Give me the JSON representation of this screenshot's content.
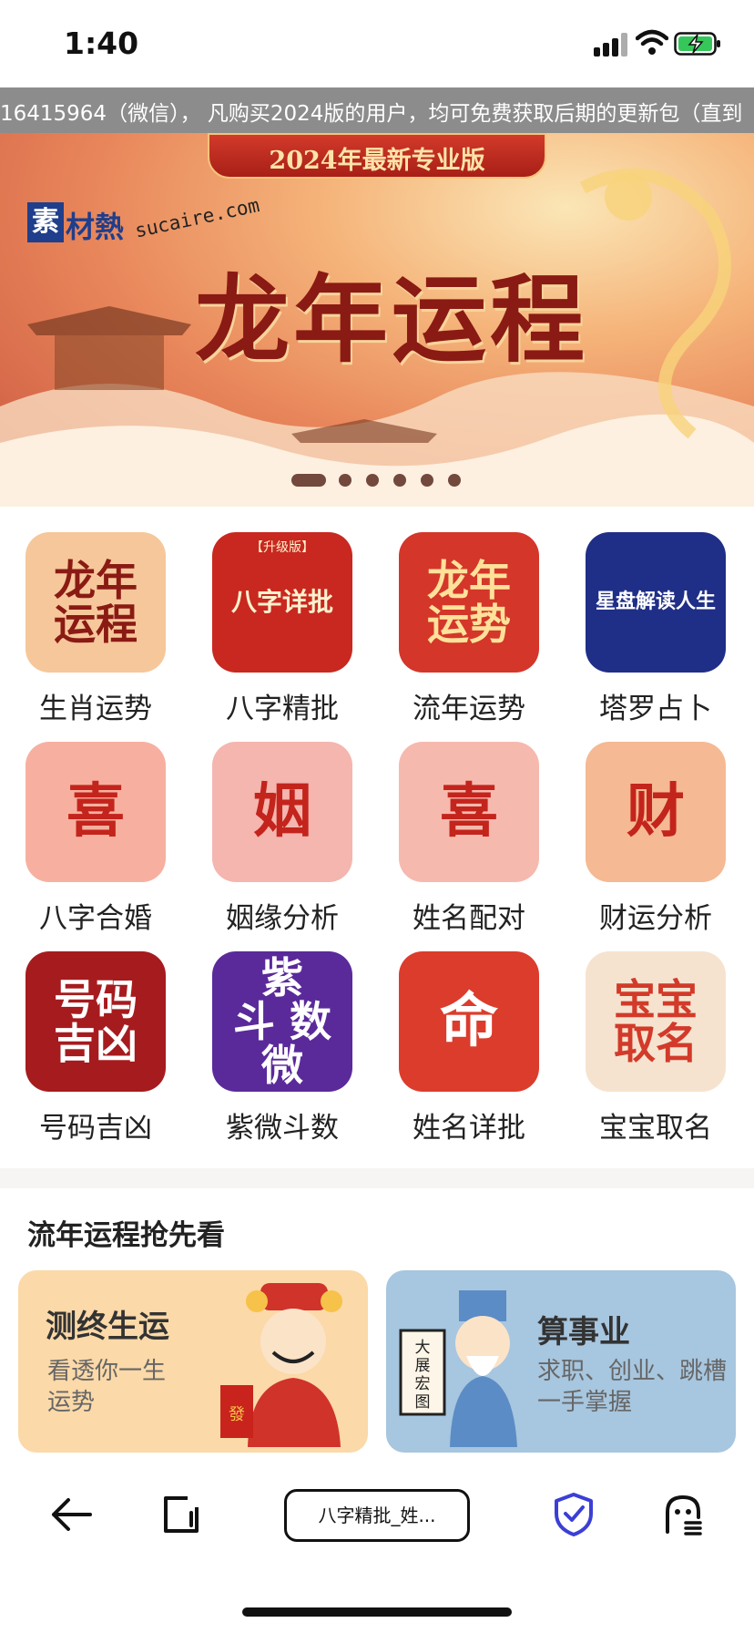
{
  "status_bar": {
    "time": "1:40"
  },
  "marquee": {
    "text": "16415964（微信）， 凡购买2024版的用户，均可免费获取后期的更新包（直到"
  },
  "banner": {
    "subtitle": "2024年最新专业版",
    "title": "龙年运程",
    "logo_char": "素",
    "logo_text": "材熱",
    "logo_url": "sucaire.com",
    "active_slide": 1,
    "slide_count": 6
  },
  "grid": {
    "items": [
      {
        "label": "生肖运势",
        "icon": "dragon-zodiac-icon",
        "glyph": "龙年\n运程",
        "bg": "#f6c79a",
        "fg": "#8a1a14"
      },
      {
        "label": "八字精批",
        "icon": "bazi-chart-icon",
        "glyph": "八字详批",
        "tag": "【升级版】",
        "bg": "#c8281f",
        "fg": "#fff1cf"
      },
      {
        "label": "流年运势",
        "icon": "dragon-fortune-icon",
        "glyph": "龙年\n运势",
        "bg": "#d4362a",
        "fg": "#ffe19a"
      },
      {
        "label": "塔罗占卜",
        "icon": "astrology-wheel-icon",
        "glyph": "星盘解读人生",
        "bg": "#1f2e86",
        "fg": "#ffffff"
      },
      {
        "label": "八字合婚",
        "icon": "bride-icon",
        "glyph": "喜",
        "bg": "#f7b0a0",
        "fg": "#c3241c"
      },
      {
        "label": "姻缘分析",
        "icon": "matchmaker-elder-icon",
        "glyph": "姻",
        "bg": "#f4b6ae",
        "fg": "#c3241c"
      },
      {
        "label": "姓名配对",
        "icon": "couple-icon",
        "glyph": "喜",
        "bg": "#f6b9ae",
        "fg": "#c3241c"
      },
      {
        "label": "财运分析",
        "icon": "god-of-wealth-icon",
        "glyph": "财",
        "bg": "#f5b993",
        "fg": "#c3241c"
      },
      {
        "label": "号码吉凶",
        "icon": "number-fortune-icon",
        "glyph": "号码\n吉凶",
        "bg": "#a61b1e",
        "fg": "#ffffff"
      },
      {
        "label": "紫微斗数",
        "icon": "ziwei-icon",
        "glyph": "紫\n斗  数\n微",
        "bg": "#5a2a9a",
        "fg": "#ffffff"
      },
      {
        "label": "姓名详批",
        "icon": "bagua-fate-icon",
        "glyph": "命",
        "bg": "#dc3c2c",
        "fg": "#ffffff"
      },
      {
        "label": "宝宝取名",
        "icon": "baby-naming-icon",
        "glyph": "宝宝\n取名",
        "bg": "#f6e3cf",
        "fg": "#d23a2a"
      }
    ]
  },
  "section": {
    "title": "流年运程抢先看"
  },
  "cards": [
    {
      "title": "测终生运",
      "desc": "看透你一生\n运势",
      "icon": "god-of-wealth-illustration-icon"
    },
    {
      "title": "算事业",
      "desc": "求职、创业、跳槽\n一手掌握",
      "icon": "sage-scroll-illustration-icon",
      "scroll_text": "大展宏图"
    }
  ],
  "toolbar": {
    "url_label": "八字精批_姓...",
    "colors": {
      "accent": "#3b3fd6"
    }
  },
  "colors": {
    "marquee_bg": "#8c8c8c",
    "card_left": "#fbd9a8",
    "card_right": "#a7c6df"
  }
}
